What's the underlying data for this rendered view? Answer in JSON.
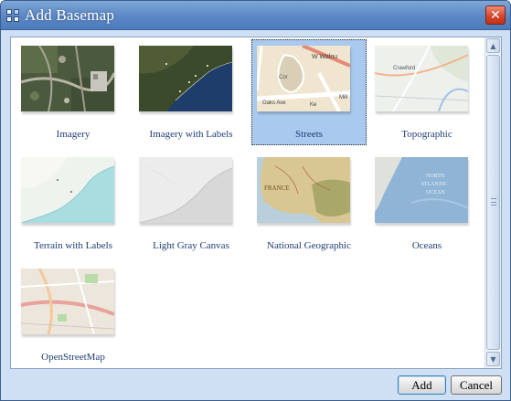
{
  "window": {
    "title": "Add Basemap",
    "close_glyph": "✕",
    "app_icon": "basemap-grid-icon",
    "colors": {
      "title_bar": "#5b87c4",
      "selection": "#a9c9ee",
      "label_text": "#1f3c74"
    }
  },
  "basemaps": [
    {
      "label": "Imagery",
      "selected": false
    },
    {
      "label": "Imagery with Labels",
      "selected": false
    },
    {
      "label": "Streets",
      "selected": true
    },
    {
      "label": "Topographic",
      "selected": false
    },
    {
      "label": "Terrain with Labels",
      "selected": false
    },
    {
      "label": "Light Gray Canvas",
      "selected": false
    },
    {
      "label": "National Geographic",
      "selected": false
    },
    {
      "label": "Oceans",
      "selected": false
    },
    {
      "label": "OpenStreetMap",
      "selected": false
    }
  ],
  "thumb_text": {
    "streets_street": "W Walnu",
    "streets_oaks": "Oaks Ave",
    "streets_ke": "Ke",
    "streets_mill": "Mill",
    "streets_cor": "Cor",
    "topo_town": "Crawford",
    "natgeo_country": "FRANCE",
    "oceans_line1": "NORTH",
    "oceans_line2": "ATLANTIC",
    "oceans_line3": "OCEAN"
  },
  "buttons": {
    "add": "Add",
    "cancel": "Cancel"
  },
  "scrollbar": {
    "up_glyph": "▲",
    "down_glyph": "▼"
  }
}
